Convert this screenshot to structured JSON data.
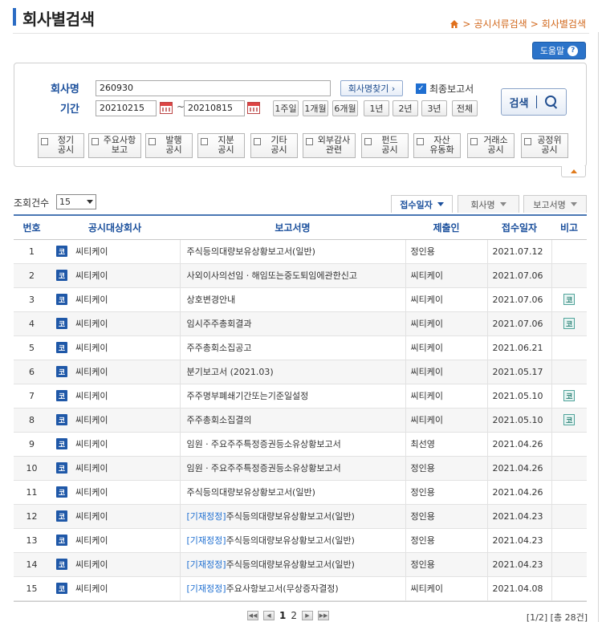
{
  "header": {
    "title": "회사별검색",
    "breadcrumb": [
      "공시서류검색",
      "회사별검색"
    ]
  },
  "help_button": {
    "label": "도움말",
    "icon": "question-icon"
  },
  "search": {
    "company_label": "회사명",
    "company_value": "260930",
    "find_company_label": "회사명찾기 ›",
    "final_report_label": "최종보고서",
    "final_report_checked": true,
    "period_label": "기간",
    "start_date": "20210215",
    "end_date": "20210815",
    "period_buttons": [
      "1주일",
      "1개월",
      "6개월",
      "1년",
      "2년",
      "3년",
      "전체"
    ],
    "search_button": "검색",
    "categories": [
      "정기\n공시",
      "주요사항\n보고",
      "발행\n공시",
      "지분\n공시",
      "기타\n공시",
      "외부감사\n관련",
      "펀드\n공시",
      "자산\n유동화",
      "거래소\n공시",
      "공정위\n공시"
    ]
  },
  "list_controls": {
    "count_label": "조회건수",
    "count_value": "15",
    "sort_buttons": [
      "접수일자",
      "회사명",
      "보고서명"
    ]
  },
  "table": {
    "headers": [
      "번호",
      "공시대상회사",
      "보고서명",
      "제출인",
      "접수일자",
      "비고"
    ],
    "rows": [
      {
        "no": "1",
        "company": "씨티케이",
        "tag": "",
        "report": "주식등의대량보유상황보고서(일반)",
        "submitter": "정인용",
        "date": "2021.07.12",
        "note": ""
      },
      {
        "no": "2",
        "company": "씨티케이",
        "tag": "",
        "report": "사외이사의선임ㆍ해임또는중도퇴임에관한신고",
        "submitter": "씨티케이",
        "date": "2021.07.06",
        "note": ""
      },
      {
        "no": "3",
        "company": "씨티케이",
        "tag": "",
        "report": "상호변경안내",
        "submitter": "씨티케이",
        "date": "2021.07.06",
        "note": "코"
      },
      {
        "no": "4",
        "company": "씨티케이",
        "tag": "",
        "report": "임시주주총회결과",
        "submitter": "씨티케이",
        "date": "2021.07.06",
        "note": "코"
      },
      {
        "no": "5",
        "company": "씨티케이",
        "tag": "",
        "report": "주주총회소집공고",
        "submitter": "씨티케이",
        "date": "2021.06.21",
        "note": ""
      },
      {
        "no": "6",
        "company": "씨티케이",
        "tag": "",
        "report": "분기보고서 (2021.03)",
        "submitter": "씨티케이",
        "date": "2021.05.17",
        "note": ""
      },
      {
        "no": "7",
        "company": "씨티케이",
        "tag": "",
        "report": "주주명부폐쇄기간또는기준일설정",
        "submitter": "씨티케이",
        "date": "2021.05.10",
        "note": "코"
      },
      {
        "no": "8",
        "company": "씨티케이",
        "tag": "",
        "report": "주주총회소집결의",
        "submitter": "씨티케이",
        "date": "2021.05.10",
        "note": "코"
      },
      {
        "no": "9",
        "company": "씨티케이",
        "tag": "",
        "report": "임원ㆍ주요주주특정증권등소유상황보고서",
        "submitter": "최선영",
        "date": "2021.04.26",
        "note": ""
      },
      {
        "no": "10",
        "company": "씨티케이",
        "tag": "",
        "report": "임원ㆍ주요주주특정증권등소유상황보고서",
        "submitter": "정인용",
        "date": "2021.04.26",
        "note": ""
      },
      {
        "no": "11",
        "company": "씨티케이",
        "tag": "",
        "report": "주식등의대량보유상황보고서(일반)",
        "submitter": "정인용",
        "date": "2021.04.26",
        "note": ""
      },
      {
        "no": "12",
        "company": "씨티케이",
        "tag": "[기재정정]",
        "report": "주식등의대량보유상황보고서(일반)",
        "submitter": "정인용",
        "date": "2021.04.23",
        "note": ""
      },
      {
        "no": "13",
        "company": "씨티케이",
        "tag": "[기재정정]",
        "report": "주식등의대량보유상황보고서(일반)",
        "submitter": "정인용",
        "date": "2021.04.23",
        "note": ""
      },
      {
        "no": "14",
        "company": "씨티케이",
        "tag": "[기재정정]",
        "report": "주식등의대량보유상황보고서(일반)",
        "submitter": "정인용",
        "date": "2021.04.23",
        "note": ""
      },
      {
        "no": "15",
        "company": "씨티케이",
        "tag": "[기재정정]",
        "report": "주요사항보고서(무상증자결정)",
        "submitter": "씨티케이",
        "date": "2021.04.08",
        "note": ""
      }
    ]
  },
  "pagination": {
    "pages": [
      "1",
      "2"
    ],
    "current": "1",
    "info": "[1/2] [총 28건]"
  },
  "corp_icon_label": "코",
  "colors": {
    "accent": "#1a4f9c",
    "breadcrumb": "#d2691e",
    "help": "#2b73c9",
    "tag": "#1f6fd1"
  }
}
